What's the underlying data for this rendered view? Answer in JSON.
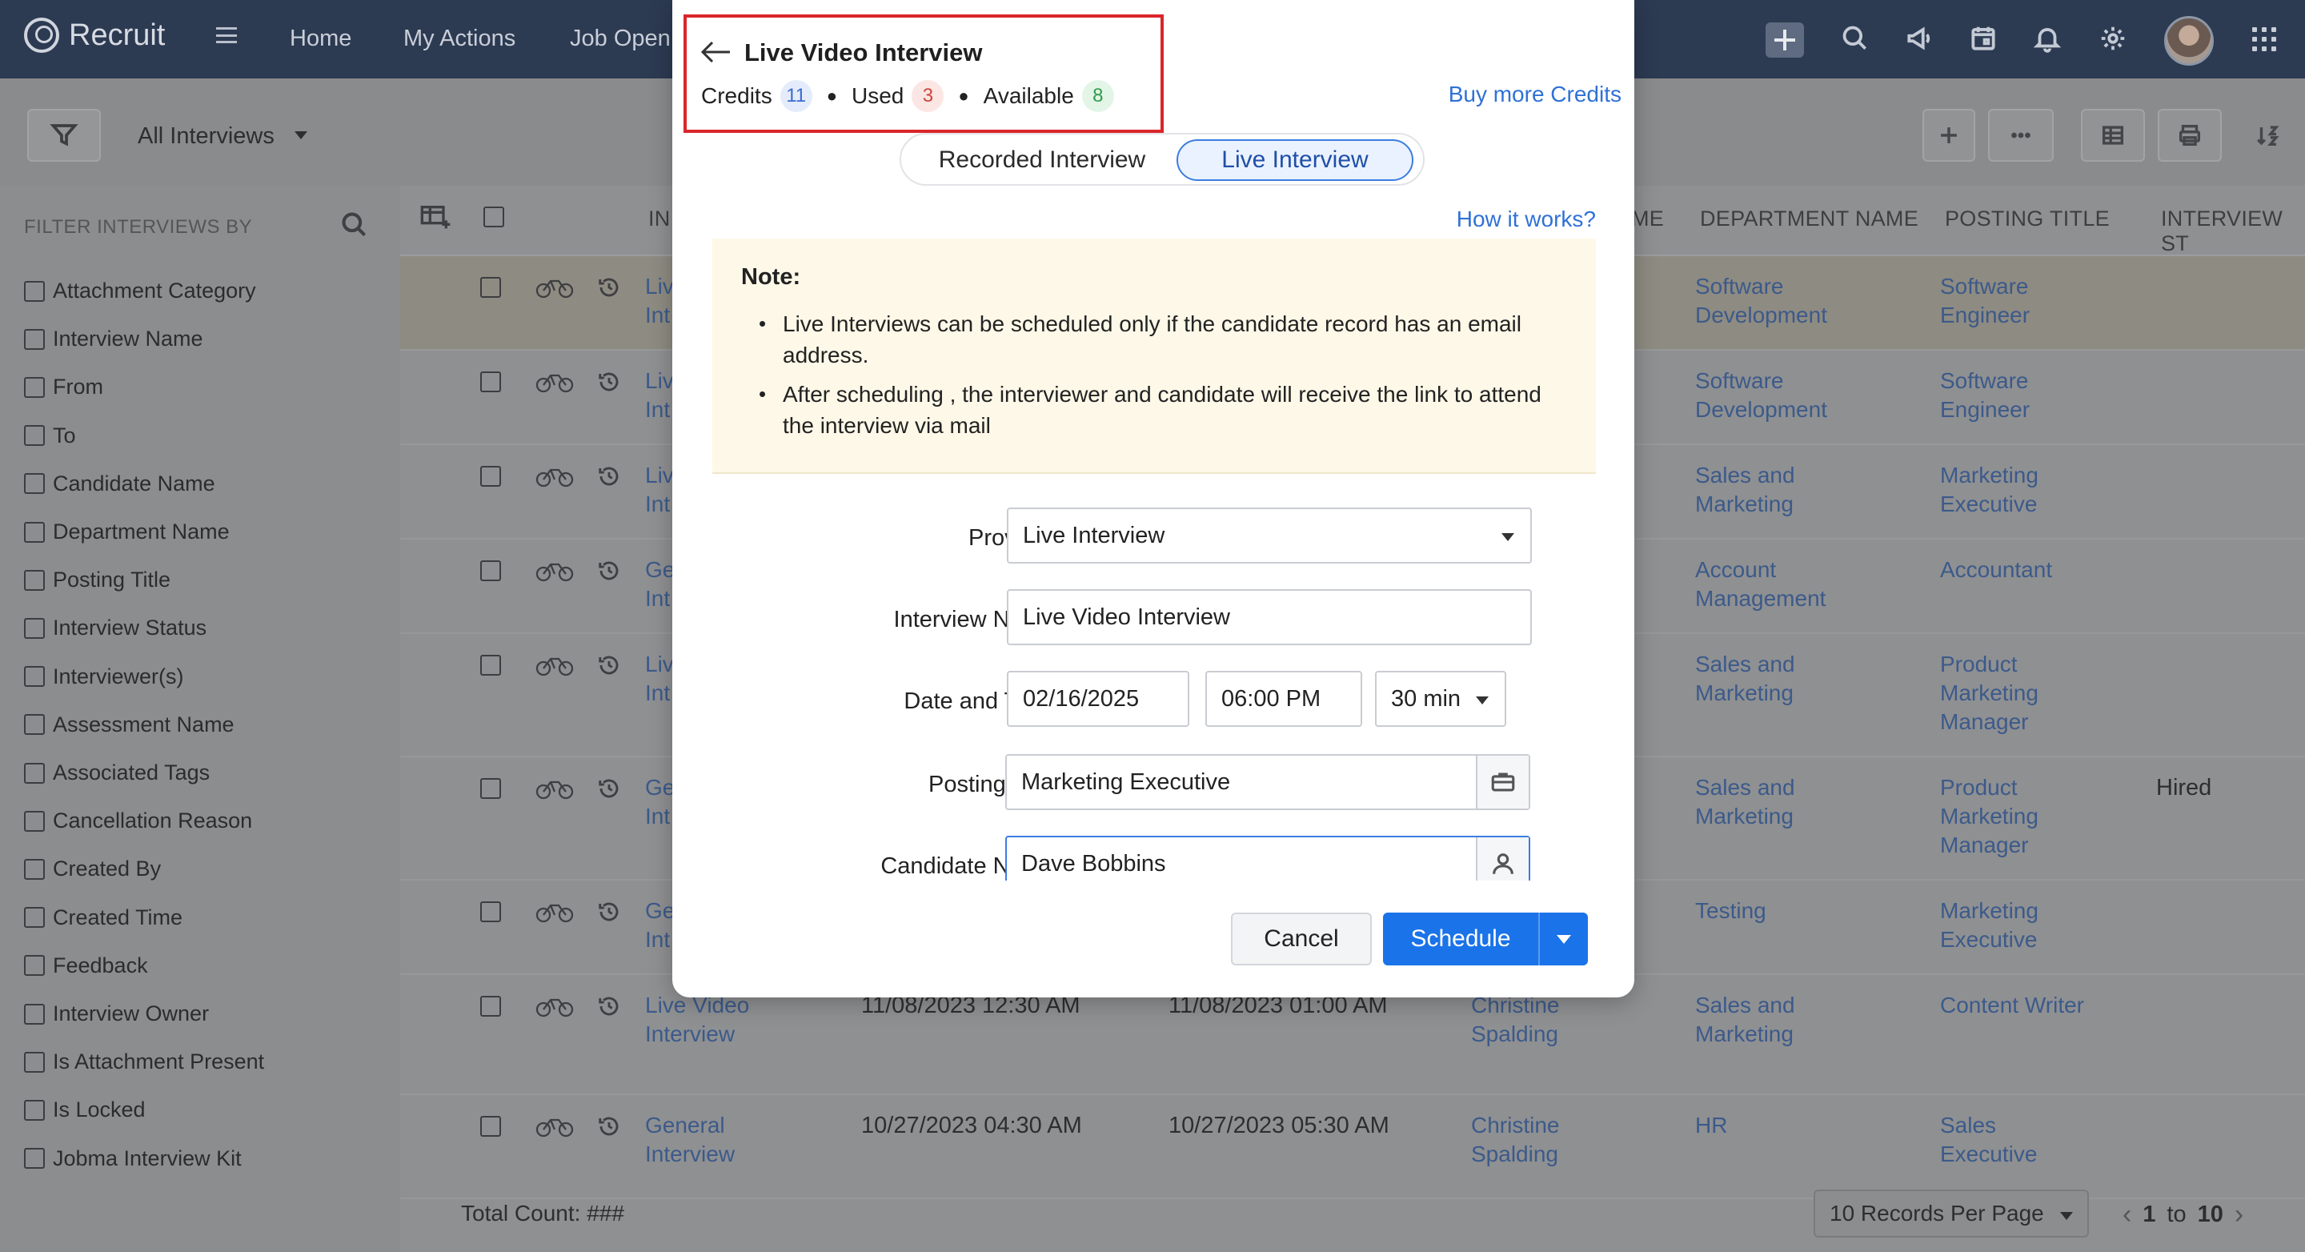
{
  "app": {
    "name": "Recruit"
  },
  "nav": {
    "items": [
      "Home",
      "My Actions",
      "Job Open"
    ]
  },
  "toolbar": {
    "view": "All Interviews"
  },
  "filters": {
    "title": "FILTER INTERVIEWS BY",
    "items": [
      "Attachment Category",
      "Interview Name",
      "From",
      "To",
      "Candidate Name",
      "Department Name",
      "Posting Title",
      "Interview Status",
      "Interviewer(s)",
      "Assessment Name",
      "Associated Tags",
      "Cancellation Reason",
      "Created By",
      "Created Time",
      "Feedback",
      "Interview Owner",
      "Is Attachment Present",
      "Is Locked",
      "Jobma Interview Kit"
    ]
  },
  "table": {
    "headers": {
      "name": "IN",
      "cand": "ME",
      "dept": "DEPARTMENT NAME",
      "posting": "POSTING TITLE",
      "status": "INTERVIEW ST"
    },
    "rows": [
      {
        "name": [
          "Liv",
          "Int"
        ],
        "dept": [
          "Software",
          "Development"
        ],
        "posting": [
          "Software",
          "Engineer"
        ],
        "status": ""
      },
      {
        "name": [
          "Liv",
          "Int"
        ],
        "dept": [
          "Software",
          "Development"
        ],
        "posting": [
          "Software",
          "Engineer"
        ],
        "status": ""
      },
      {
        "name": [
          "Liv",
          "Int"
        ],
        "dept": [
          "Sales and",
          "Marketing"
        ],
        "posting": [
          "Marketing",
          "Executive"
        ],
        "status": ""
      },
      {
        "name": [
          "Ge",
          "Int"
        ],
        "dept": [
          "Account",
          "Management"
        ],
        "posting": [
          "Accountant",
          ""
        ],
        "status": ""
      },
      {
        "name": [
          "Liv",
          "Int"
        ],
        "dept": [
          "Sales and",
          "Marketing"
        ],
        "posting": [
          "Product",
          "Marketing",
          "Manager"
        ],
        "status": ""
      },
      {
        "name": [
          "Ge",
          "Int"
        ],
        "dept": [
          "Sales and",
          "Marketing"
        ],
        "posting": [
          "Product",
          "Marketing",
          "Manager"
        ],
        "status": "Hired"
      },
      {
        "name": [
          "Ge",
          "Int"
        ],
        "dept": [
          "Testing",
          ""
        ],
        "posting": [
          "Marketing",
          "Executive"
        ],
        "status": ""
      },
      {
        "name": [
          "Live Video",
          "Interview"
        ],
        "from": "11/08/2023 12:30 AM",
        "to": "11/08/2023 01:00 AM",
        "cand": [
          "Christine",
          "Spalding"
        ],
        "dept": [
          "Sales and",
          "Marketing"
        ],
        "posting": [
          "Content Writer",
          ""
        ],
        "status": ""
      },
      {
        "name": [
          "General",
          "Interview"
        ],
        "from": "10/27/2023 04:30 AM",
        "to": "10/27/2023 05:30 AM",
        "cand": [
          "Christine",
          "Spalding"
        ],
        "dept": [
          "HR",
          ""
        ],
        "posting": [
          "Sales",
          "Executive"
        ],
        "status": ""
      }
    ]
  },
  "footer": {
    "total": "Total Count: ###",
    "records": "10 Records Per Page",
    "page_from": "1",
    "page_sep": "to",
    "page_to": "10"
  },
  "modal": {
    "title": "Live Video Interview",
    "credits_label": "Credits",
    "credits": "11",
    "used_label": "Used",
    "used": "3",
    "available_label": "Available",
    "available": "8",
    "buy_more": "Buy more Credits",
    "toggle": {
      "recorded": "Recorded Interview",
      "live": "Live Interview"
    },
    "how_it_works": "How it works?",
    "note": {
      "title": "Note:",
      "items": [
        "Live Interviews can be scheduled only if the candidate record has an email address.",
        "After scheduling , the interviewer and candidate will receive the link to attend the interview via mail"
      ]
    },
    "form": {
      "provider_label": "Provider",
      "provider": "Live Interview",
      "name_label": "Interview Name",
      "name": "Live Video Interview",
      "datetime_label": "Date and Time",
      "date": "02/16/2025",
      "time": "06:00 PM",
      "duration": "30 min",
      "posting_label": "Posting Title",
      "posting": "Marketing Executive",
      "candidate_label": "Candidate Name",
      "candidate": "Dave Bobbins",
      "required_mark": "*"
    },
    "cancel": "Cancel",
    "schedule": "Schedule"
  }
}
